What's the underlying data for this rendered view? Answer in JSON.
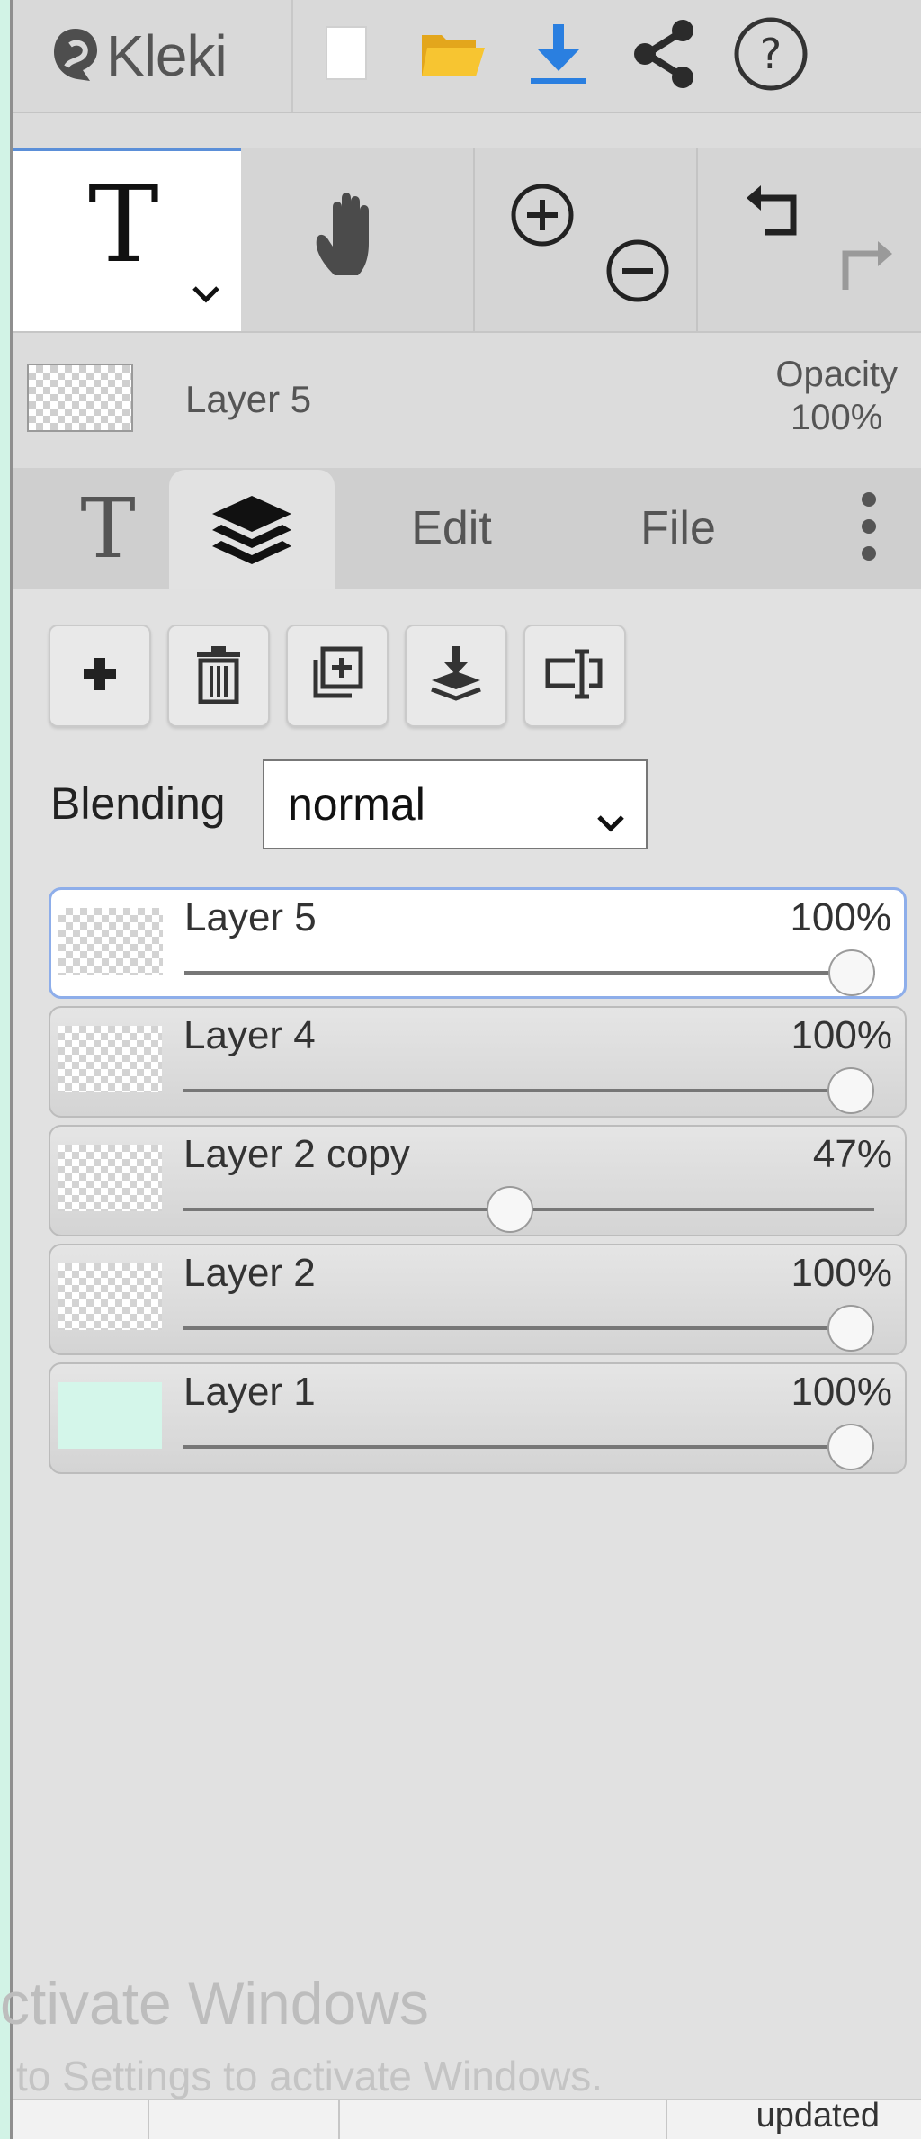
{
  "app": {
    "name": "Kleki"
  },
  "toolbar": {
    "new_icon": "new-file-icon",
    "open_icon": "open-folder-icon",
    "save_icon": "download-icon",
    "share_icon": "share-icon",
    "help_icon": "help-icon"
  },
  "tools": {
    "text_glyph": "T",
    "hand_icon": "hand-icon",
    "zoom_in_icon": "zoom-in-icon",
    "zoom_out_icon": "zoom-out-icon",
    "undo_icon": "undo-icon",
    "redo_icon": "redo-icon"
  },
  "current_layer": {
    "name": "Layer 5",
    "opacity_label": "Opacity",
    "opacity_value": "100%"
  },
  "tabs": {
    "text_glyph": "T",
    "layers_icon": "layers-icon",
    "edit": "Edit",
    "file": "File",
    "more_icon": "more-vertical-icon"
  },
  "layer_actions": [
    "add-layer",
    "delete-layer",
    "duplicate-layer",
    "merge-down",
    "rename-layer"
  ],
  "blending": {
    "label": "Blending",
    "value": "normal"
  },
  "layers": [
    {
      "name": "Layer 5",
      "opacity": "100%",
      "opacity_fraction": 1.0,
      "active": true,
      "thumb": "transparent"
    },
    {
      "name": "Layer 4",
      "opacity": "100%",
      "opacity_fraction": 1.0,
      "active": false,
      "thumb": "transparent"
    },
    {
      "name": "Layer 2 copy",
      "opacity": "47%",
      "opacity_fraction": 0.47,
      "active": false,
      "thumb": "transparent"
    },
    {
      "name": "Layer 2",
      "opacity": "100%",
      "opacity_fraction": 1.0,
      "active": false,
      "thumb": "transparent"
    },
    {
      "name": "Layer 1",
      "opacity": "100%",
      "opacity_fraction": 1.0,
      "active": false,
      "thumb": "solid"
    }
  ],
  "layer1_fill": "#d4f6ea",
  "accent": "#5b8fd8",
  "watermark": {
    "line1": "ctivate Windows",
    "line2": "to Settings to activate Windows."
  },
  "footer": {
    "text": "updated"
  }
}
